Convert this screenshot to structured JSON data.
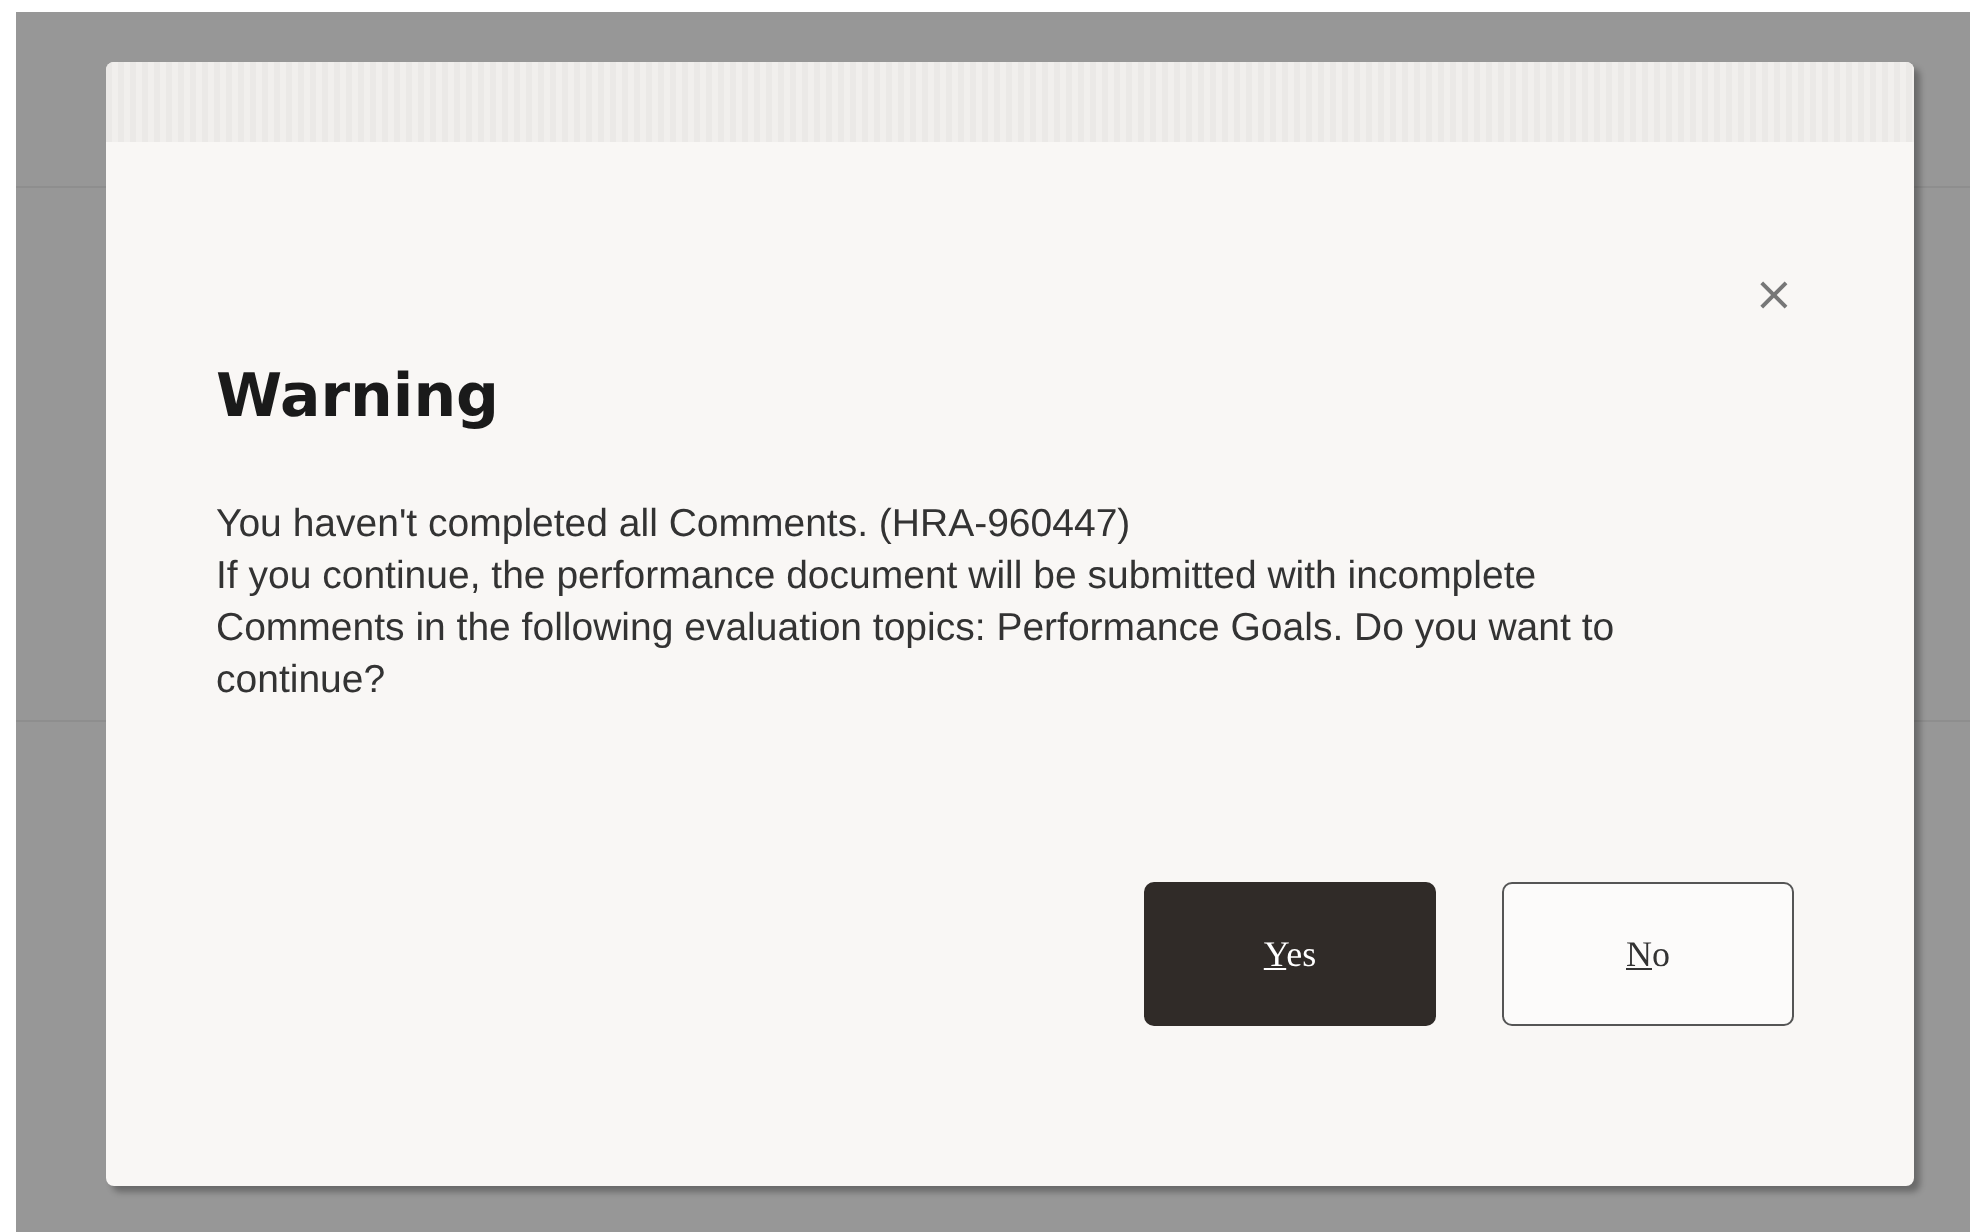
{
  "dialog": {
    "title": "Warning",
    "close": "×",
    "message": [
      "You haven't completed all Comments. (HRA-960447)",
      "If you continue, the performance document will be submitted with incomplete Comments in the following evaluation topics: Performance Goals. Do you want to continue?"
    ],
    "buttons": [
      {
        "label": "Yes",
        "kind": "primary",
        "mnemonic_underlined": true
      },
      {
        "label": "No",
        "kind": "secondary",
        "mnemonic_underlined": true
      }
    ]
  }
}
